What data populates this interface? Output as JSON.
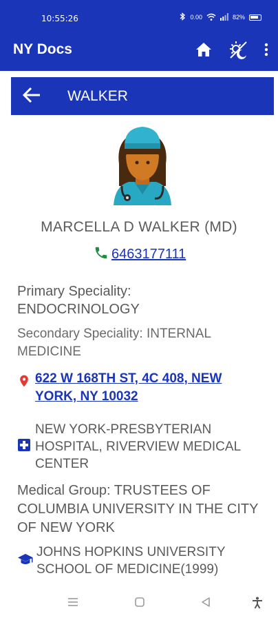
{
  "status": {
    "time": "10:55:26",
    "net_speed": "0.00",
    "battery": "82%"
  },
  "app": {
    "title": "NY Docs"
  },
  "subheader": {
    "title": "WALKER"
  },
  "doctor": {
    "name": "MARCELLA D WALKER (MD)",
    "phone": "6463177111",
    "primary_label": "Primary Speciality:",
    "primary_value": "ENDOCRINOLOGY",
    "secondary": "Secondary Speciality: INTERNAL MEDICINE",
    "address": "622 W 168TH ST, 4C 408, NEW YORK, NY 10032",
    "hospital": "NEW YORK-PRESBYTERIAN HOSPITAL, RIVERVIEW MEDICAL CENTER",
    "medical_group": "Medical Group: TRUSTEES OF COLUMBIA UNIVERSITY IN THE CITY OF NEW YORK",
    "school": "JOHNS HOPKINS UNIVERSITY SCHOOL OF MEDICINE(1999)"
  },
  "colors": {
    "primary": "#1a35b8",
    "phone_icon": "#1e8e3e",
    "pin": "#e53935",
    "hospital_icon": "#1a35b8"
  },
  "icons": [
    "home-icon",
    "theme-toggle-icon",
    "more-vert-icon",
    "back-arrow-icon",
    "phone-icon",
    "location-pin-icon",
    "hospital-icon",
    "graduation-cap-icon"
  ]
}
